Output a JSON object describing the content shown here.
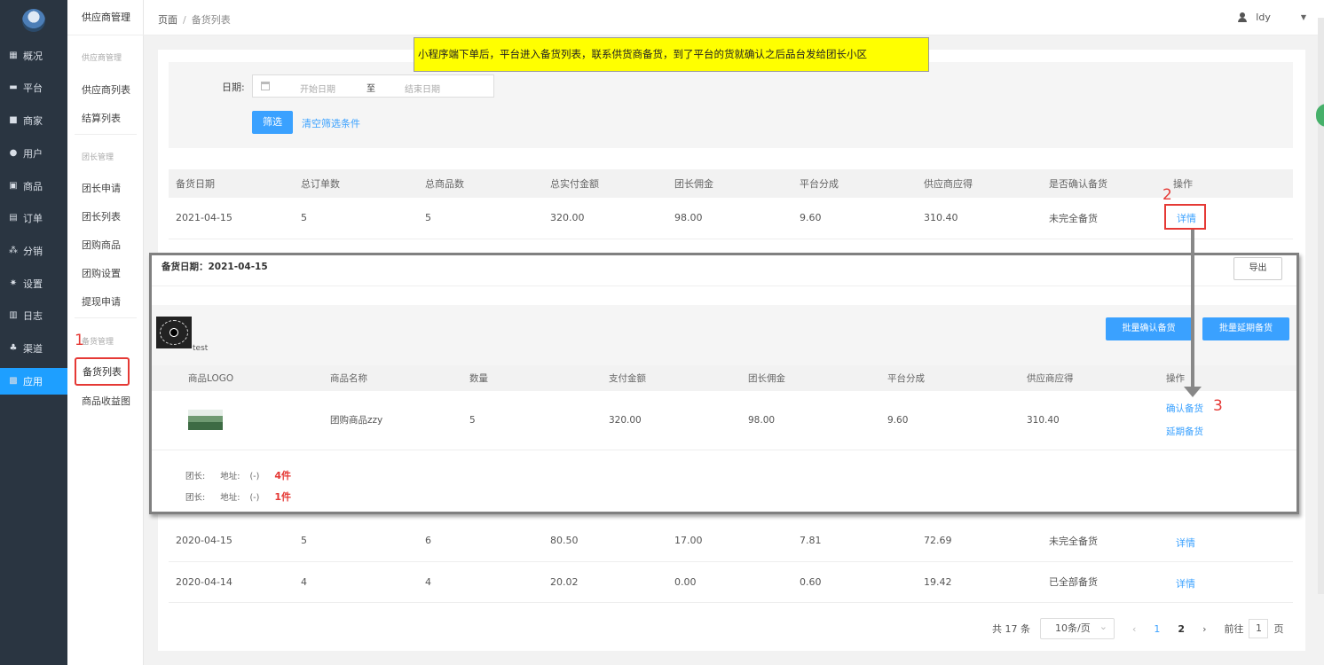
{
  "sidebar": {
    "items": [
      {
        "label": "概况",
        "icon": "dashboard-icon"
      },
      {
        "label": "平台",
        "icon": "monitor-icon"
      },
      {
        "label": "商家",
        "icon": "store-icon"
      },
      {
        "label": "用户",
        "icon": "user-icon"
      },
      {
        "label": "商品",
        "icon": "goods-icon"
      },
      {
        "label": "订单",
        "icon": "order-icon"
      },
      {
        "label": "分销",
        "icon": "distribution-icon"
      },
      {
        "label": "设置",
        "icon": "gear-icon"
      },
      {
        "label": "日志",
        "icon": "log-icon"
      },
      {
        "label": "渠道",
        "icon": "channel-icon"
      },
      {
        "label": "应用",
        "icon": "apps-icon"
      }
    ]
  },
  "submenu": {
    "title": "供应商管理",
    "group1": "供应商管理",
    "supplier_list": "供应商列表",
    "settlement_list": "结算列表",
    "group2": "团长管理",
    "leader_apply": "团长申请",
    "leader_list": "团长列表",
    "group_goods": "团购商品",
    "group_settings": "团购设置",
    "withdraw_apply": "提现申请",
    "group3": "备货管理",
    "stock_list": "备货列表",
    "goods_income_chart": "商品收益图"
  },
  "header": {
    "crumb_root": "页面",
    "crumb_sep": "/",
    "crumb_current": "备货列表",
    "username": "ldy"
  },
  "annotation": {
    "note": "小程序端下单后，平台进入备货列表，联系供货商备货，到了平台的货就确认之后品台发给团长小区",
    "num1": "1",
    "num2": "2",
    "num3": "3"
  },
  "filter": {
    "label": "日期:",
    "start_placeholder": "开始日期",
    "to": "至",
    "end_placeholder": "结束日期",
    "filter_button": "筛选",
    "clear_link": "清空筛选条件"
  },
  "list": {
    "headers": [
      "备货日期",
      "总订单数",
      "总商品数",
      "总实付金额",
      "团长佣金",
      "平台分成",
      "供应商应得",
      "是否确认备货",
      "操作"
    ],
    "rows": [
      [
        "2021-04-15",
        "5",
        "5",
        "320.00",
        "98.00",
        "9.60",
        "310.40",
        "未完全备货",
        "详情"
      ],
      [
        "2020-04-15",
        "5",
        "6",
        "80.50",
        "17.00",
        "7.81",
        "72.69",
        "未完全备货",
        "详情"
      ],
      [
        "2020-04-14",
        "4",
        "4",
        "20.02",
        "0.00",
        "0.60",
        "19.42",
        "已全部备货",
        "详情"
      ]
    ]
  },
  "detail": {
    "title": "备货日期：2021-04-15",
    "export": "导出",
    "shop_name": "test",
    "batch_confirm": "批量确认备货",
    "batch_delay": "批量延期备货",
    "headers": [
      "商品LOGO",
      "商品名称",
      "数量",
      "支付金额",
      "团长佣金",
      "平台分成",
      "供应商应得",
      "操作"
    ],
    "row": {
      "name": "团购商品zzy",
      "qty": "5",
      "pay": "320.00",
      "commission": "98.00",
      "platform": "9.60",
      "supplier": "310.40",
      "confirm": "确认备货",
      "delay": "延期备货"
    },
    "leaders": [
      {
        "leader": "团长:",
        "address": "地址:",
        "value": "(-)",
        "count": "4件"
      },
      {
        "leader": "团长:",
        "address": "地址:",
        "value": "(-)",
        "count": "1件"
      }
    ]
  },
  "pager": {
    "total": "共 17 条",
    "page_size": "10条/页",
    "prev": "‹",
    "page1": "1",
    "page2": "2",
    "next": "›",
    "goto": "前往",
    "goto_value": "1",
    "page_suffix": "页"
  },
  "colors": {
    "nav_bg": "#2a3541",
    "accent": "#3aa1ff",
    "annotation_red": "#e53935",
    "note_bg": "#ffff00"
  }
}
